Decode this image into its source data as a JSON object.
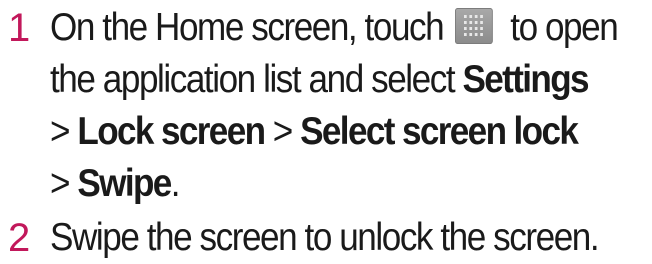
{
  "steps": [
    {
      "number": "1",
      "line1_before": "On the Home screen, touch ",
      "icon": "app-grid-icon",
      "line1_after": " to open",
      "line2_before": "the application list and select ",
      "line2_bold": "Settings",
      "line3_prefix": "> ",
      "line3_bold1": "Lock screen",
      "line3_sep": " > ",
      "line3_bold2": "Select screen lock",
      "line4_prefix": "> ",
      "line4_bold": "Swipe",
      "line4_suffix": "."
    },
    {
      "number": "2",
      "text": "Swipe the screen to unlock the screen."
    }
  ],
  "colors": {
    "step_number": "#c2185b",
    "text": "#1a1a1a",
    "icon_bg": "#9a9a9a"
  }
}
